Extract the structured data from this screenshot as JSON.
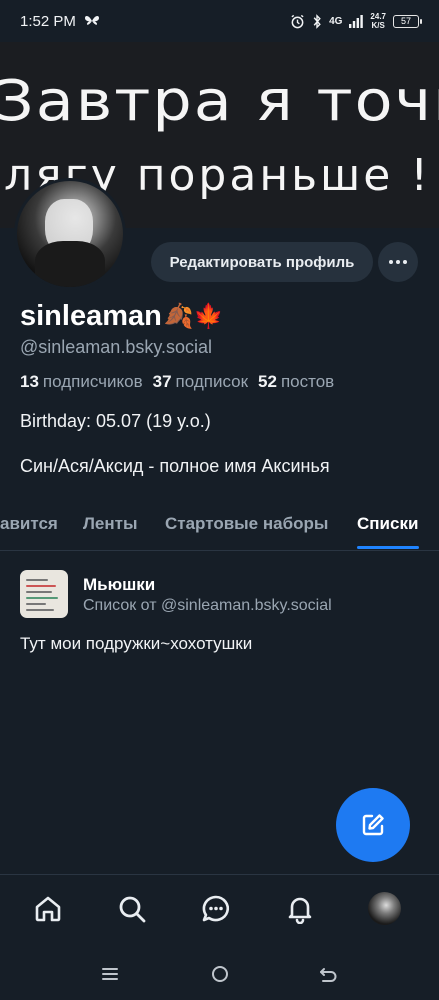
{
  "status_bar": {
    "time": "1:52 PM",
    "network": "4G",
    "speed": "24.7",
    "speed_unit": "K/S",
    "battery": "57",
    "icons": [
      "butterfly-icon",
      "alarm-icon",
      "bluetooth-icon",
      "signal-icon",
      "battery-icon"
    ]
  },
  "banner": {
    "line1": "Завтра я точно",
    "line2": "лягу пораньше !"
  },
  "profile": {
    "edit_button": "Редактировать профиль",
    "more_button": "···",
    "display_name": "sinleaman",
    "name_emoji": "🍂🍁",
    "handle": "@sinleaman.bsky.social",
    "followers_count": "13",
    "followers_label": "подписчиков",
    "following_count": "37",
    "following_label": "подписок",
    "posts_count": "52",
    "posts_label": "постов",
    "bio_line1": "Birthday: 05.07 (19 y.o.)",
    "bio_line2": "Син/Ася/Аксид - полное имя Аксинья"
  },
  "tabs": [
    {
      "label": "авится",
      "active": false
    },
    {
      "label": "Ленты",
      "active": false
    },
    {
      "label": "Стартовые наборы",
      "active": false
    },
    {
      "label": "Списки",
      "active": true
    }
  ],
  "list_item": {
    "title": "Мьюшки",
    "subtitle": "Список от @sinleaman.bsky.social",
    "description": "Тут мои подружки~хохотушки"
  },
  "bottom_nav": {
    "items": [
      "home-icon",
      "search-icon",
      "chat-icon",
      "bell-icon",
      "profile-avatar"
    ]
  },
  "system_nav": {
    "items": [
      "recents-icon",
      "home-circle-icon",
      "back-icon"
    ]
  },
  "colors": {
    "background": "#161e27",
    "accent": "#1f84ff",
    "fab": "#1e7af2",
    "muted_text": "#9aa6b2"
  }
}
